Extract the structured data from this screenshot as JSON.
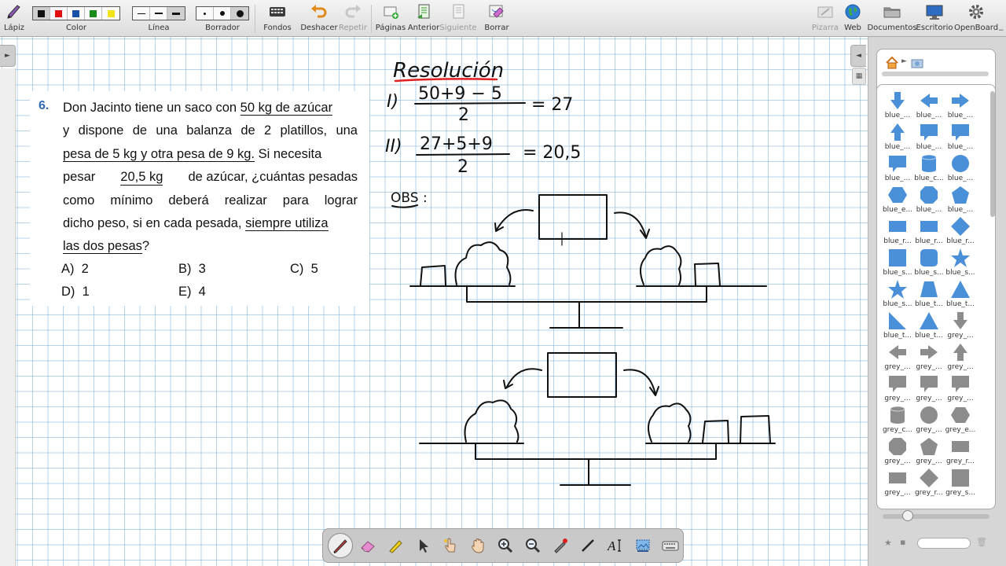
{
  "toolbar": {
    "pen_label": "Lápiz",
    "color_label": "Color",
    "line_label": "Línea",
    "eraser_label": "Borrador",
    "backgrounds_label": "Fondos",
    "undo_label": "Deshacer",
    "redo_label": "Repetir",
    "pages_label": "Páginas",
    "previous_label": "Anterior",
    "next_label": "Siguiente",
    "erase_label": "Borrar",
    "board_label": "Pizarra",
    "web_label": "Web",
    "documents_label": "Documentos",
    "desktop_label": "Escritorio",
    "openboard_label": "OpenBoard",
    "colors": [
      "#111111",
      "#e01010",
      "#1a4fa8",
      "#1a8a1a",
      "#f2e21a"
    ]
  },
  "problem": {
    "number": "6.",
    "l1a": "Don Jacinto tiene un saco con ",
    "l1b": "50 kg de azúcar",
    "l2": [
      "y",
      "dispone",
      "de",
      "una",
      "balanza",
      "de",
      "2",
      "platillos,",
      "una"
    ],
    "l3a": "pesa de 5 kg y otra pesa de 9 kg.",
    "l3b": " Si necesita",
    "l4a": "pesar",
    "l4b": "20,5 kg",
    "l4c": "de azúcar, ¿cuántas pesadas",
    "l5": [
      "como",
      "mínimo",
      "deberá",
      "realizar",
      "para",
      "lograr"
    ],
    "l6a": "dicho peso, si en cada pesada, ",
    "l6b": "siempre utiliza",
    "l7a": "las dos pesas",
    "l7b": "?",
    "options": [
      {
        "letter": "A)",
        "value": "2"
      },
      {
        "letter": "B)",
        "value": "3"
      },
      {
        "letter": "C)",
        "value": "5"
      },
      {
        "letter": "D)",
        "value": "1"
      },
      {
        "letter": "E)",
        "value": "4"
      }
    ]
  },
  "handwriting": {
    "title": "Resolución",
    "step1_label": "I)",
    "step1_num": "50+9 − 5",
    "step1_den": "2",
    "step1_result": "= 27",
    "step2_label": "II)",
    "step2_num": "27+5+9",
    "step2_den": "2",
    "step2_result": "= 20,5",
    "obs": "OBS :",
    "ink_color": "#111111",
    "title_underline_color": "#e02020"
  },
  "library": {
    "items": [
      {
        "label": "blue_...",
        "icon": "arrow-down-icon",
        "color": "#4a90d9"
      },
      {
        "label": "blue_...",
        "icon": "arrow-left-icon",
        "color": "#4a90d9"
      },
      {
        "label": "blue_...",
        "icon": "arrow-right-icon",
        "color": "#4a90d9"
      },
      {
        "label": "blue_...",
        "icon": "arrow-up-icon",
        "color": "#4a90d9"
      },
      {
        "label": "blue_...",
        "icon": "callout-icon",
        "color": "#4a90d9"
      },
      {
        "label": "blue_...",
        "icon": "callout-icon",
        "color": "#4a90d9"
      },
      {
        "label": "blue_...",
        "icon": "callout-icon",
        "color": "#4a90d9"
      },
      {
        "label": "blue_c...",
        "icon": "cylinder-icon",
        "color": "#4a90d9"
      },
      {
        "label": "blue_...",
        "icon": "circle-icon",
        "color": "#4a90d9"
      },
      {
        "label": "blue_e...",
        "icon": "hexagon-icon",
        "color": "#4a90d9"
      },
      {
        "label": "blue_...",
        "icon": "octagon-icon",
        "color": "#4a90d9"
      },
      {
        "label": "blue_...",
        "icon": "pentagon-icon",
        "color": "#4a90d9"
      },
      {
        "label": "blue_r...",
        "icon": "rectangle-icon",
        "color": "#4a90d9"
      },
      {
        "label": "blue_r...",
        "icon": "rectangle-icon",
        "color": "#4a90d9"
      },
      {
        "label": "blue_r...",
        "icon": "diamond-icon",
        "color": "#4a90d9"
      },
      {
        "label": "blue_s...",
        "icon": "square-icon",
        "color": "#4a90d9"
      },
      {
        "label": "blue_s...",
        "icon": "rounded-square-icon",
        "color": "#4a90d9"
      },
      {
        "label": "blue_s...",
        "icon": "star-icon",
        "color": "#4a90d9"
      },
      {
        "label": "blue_s...",
        "icon": "star-icon",
        "color": "#4a90d9"
      },
      {
        "label": "blue_t...",
        "icon": "trapezoid-icon",
        "color": "#4a90d9"
      },
      {
        "label": "blue_t...",
        "icon": "triangle-icon",
        "color": "#4a90d9"
      },
      {
        "label": "blue_t...",
        "icon": "right-triangle-icon",
        "color": "#4a90d9"
      },
      {
        "label": "blue_t...",
        "icon": "triangle-icon",
        "color": "#4a90d9"
      },
      {
        "label": "grey_...",
        "icon": "arrow-down-icon",
        "color": "#8c8c8c"
      },
      {
        "label": "grey_...",
        "icon": "arrow-left-icon",
        "color": "#8c8c8c"
      },
      {
        "label": "grey_...",
        "icon": "arrow-right-icon",
        "color": "#8c8c8c"
      },
      {
        "label": "grey_...",
        "icon": "arrow-up-icon",
        "color": "#8c8c8c"
      },
      {
        "label": "grey_...",
        "icon": "callout-icon",
        "color": "#8c8c8c"
      },
      {
        "label": "grey_...",
        "icon": "callout-icon",
        "color": "#8c8c8c"
      },
      {
        "label": "grey_...",
        "icon": "callout-icon",
        "color": "#8c8c8c"
      },
      {
        "label": "grey_c...",
        "icon": "cylinder-icon",
        "color": "#8c8c8c"
      },
      {
        "label": "grey_...",
        "icon": "circle-icon",
        "color": "#8c8c8c"
      },
      {
        "label": "grey_e...",
        "icon": "hexagon-icon",
        "color": "#8c8c8c"
      },
      {
        "label": "grey_...",
        "icon": "octagon-icon",
        "color": "#8c8c8c"
      },
      {
        "label": "grey_...",
        "icon": "pentagon-icon",
        "color": "#8c8c8c"
      },
      {
        "label": "grey_r...",
        "icon": "rectangle-icon",
        "color": "#8c8c8c"
      },
      {
        "label": "grey_...",
        "icon": "rectangle-icon",
        "color": "#8c8c8c"
      },
      {
        "label": "grey_r...",
        "icon": "diamond-icon",
        "color": "#8c8c8c"
      },
      {
        "label": "grey_s...",
        "icon": "square-icon",
        "color": "#8c8c8c"
      }
    ]
  }
}
